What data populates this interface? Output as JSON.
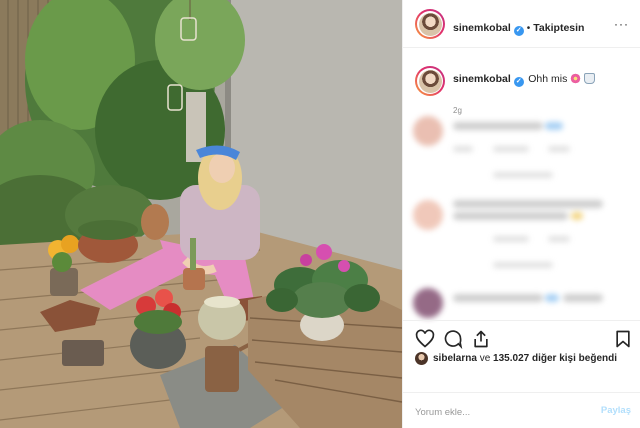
{
  "post": {
    "username": "sinemkobal",
    "verified_icon": "verified-badge-icon",
    "separator": "•",
    "follow_status": "Takiptesin",
    "more_icon": "more-options-icon",
    "more_glyph": "···"
  },
  "caption": {
    "username": "sinemkobal",
    "text": "Ohh mis",
    "emojis": [
      "flower-emoji-icon",
      "cup-emoji-icon"
    ],
    "time": "2g"
  },
  "actions": {
    "icons": [
      "heart-icon",
      "comment-icon",
      "share-icon",
      "bookmark-icon"
    ]
  },
  "likes": {
    "first_user": "sibelarna",
    "connector": "ve",
    "count": "135.027",
    "suffix": "diğer kişi beğendi"
  },
  "comment_box": {
    "placeholder": "Yorum ekle...",
    "submit_label": "Paylaş"
  },
  "colors": {
    "verified": "#3897f0",
    "story_ring_start": "#f9a13c",
    "story_ring_end": "#c13584",
    "share_disabled": "#b2dffc"
  }
}
